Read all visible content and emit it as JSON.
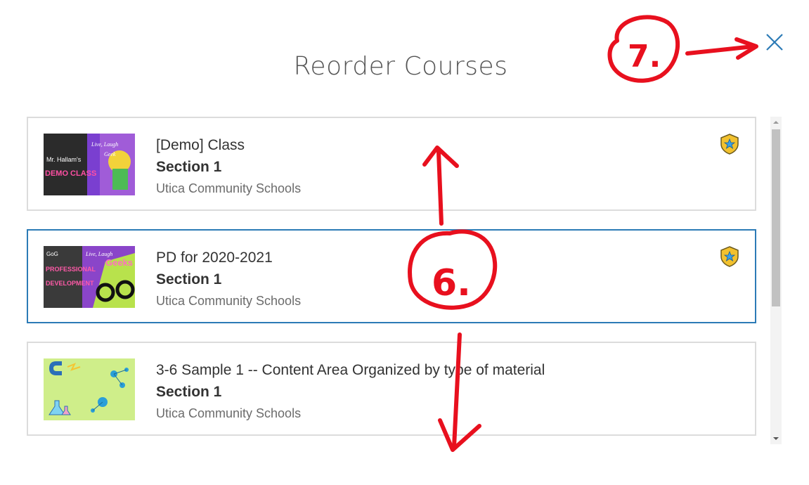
{
  "dialog": {
    "title": "Reorder Courses",
    "close_icon": "close-icon"
  },
  "courses": [
    {
      "name": "[Demo] Class",
      "section": "Section 1",
      "org": "Utica Community Schools",
      "thumb_lines": [
        "Mr. Hallam's",
        "DEMO CLASS",
        "Live, Laugh",
        "Geek"
      ],
      "has_badge": true
    },
    {
      "name": "PD for 2020-2021",
      "section": "Section 1",
      "org": "Utica Community Schools",
      "thumb_lines": [
        "GoG",
        "PROFESSIONAL",
        "DEVELOPMENT",
        "Live, Laugh",
        "Geeks"
      ],
      "has_badge": true,
      "selected": true
    },
    {
      "name": "3-6 Sample 1 -- Content Area Organized by type of material",
      "section": "Section 1",
      "org": "Utica Community Schools",
      "has_badge": false
    }
  ],
  "annotations": {
    "label_6": "6.",
    "label_7": "7."
  },
  "colors": {
    "accent": "#2c7bb6",
    "annotation": "#e8101e",
    "badge": "#f2c12e"
  }
}
